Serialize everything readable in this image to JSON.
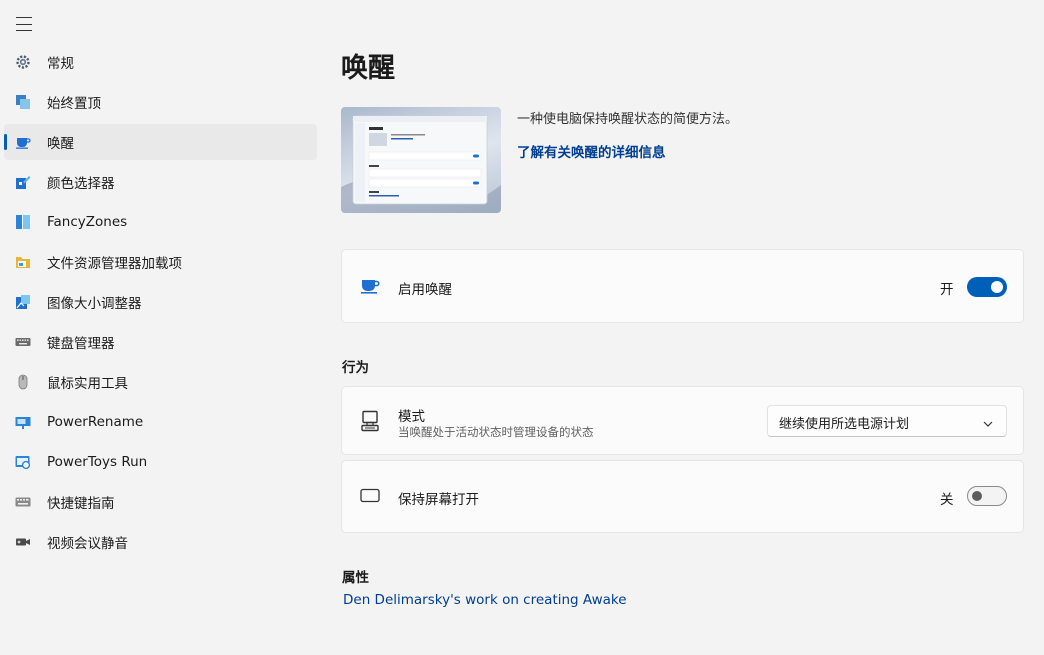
{
  "sidebar": {
    "items": [
      {
        "label": "常规",
        "icon": "gear-icon"
      },
      {
        "label": "始终置顶",
        "icon": "always-on-top-icon"
      },
      {
        "label": "唤醒",
        "icon": "coffee-cup-icon",
        "selected": true
      },
      {
        "label": "颜色选择器",
        "icon": "color-picker-icon"
      },
      {
        "label": "FancyZones",
        "icon": "fancyzones-icon"
      },
      {
        "label": "文件资源管理器加载项",
        "icon": "folder-icon"
      },
      {
        "label": "图像大小调整器",
        "icon": "image-resizer-icon"
      },
      {
        "label": "键盘管理器",
        "icon": "keyboard-icon"
      },
      {
        "label": "鼠标实用工具",
        "icon": "mouse-icon"
      },
      {
        "label": "PowerRename",
        "icon": "power-rename-icon"
      },
      {
        "label": "PowerToys Run",
        "icon": "powertoys-run-icon"
      },
      {
        "label": "快捷键指南",
        "icon": "shortcut-guide-icon"
      },
      {
        "label": "视频会议静音",
        "icon": "camera-icon"
      }
    ]
  },
  "main": {
    "title": "唤醒",
    "description": "一种使电脑保持唤醒状态的简便方法。",
    "learn_more": "了解有关唤醒的详细信息",
    "enable_card": {
      "label": "启用唤醒",
      "state": "开",
      "on": true
    },
    "behavior": {
      "title": "行为",
      "mode": {
        "label": "模式",
        "sublabel": "当唤醒处于活动状态时管理设备的状态",
        "selected": "继续使用所选电源计划"
      },
      "keep_screen": {
        "label": "保持屏幕打开",
        "state": "关",
        "on": false
      }
    },
    "attribution": {
      "title": "属性",
      "link": "Den Delimarsky's work on creating Awake"
    }
  },
  "colors": {
    "accent": "#005fb8",
    "link": "#003e92",
    "background": "#f3f3f3",
    "card": "#fbfbfb"
  }
}
